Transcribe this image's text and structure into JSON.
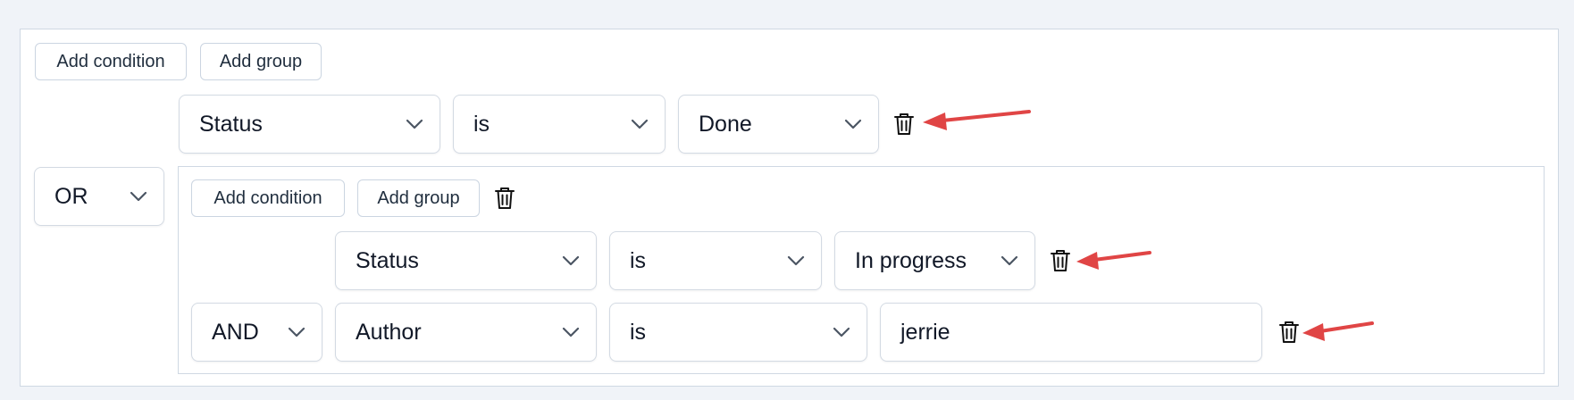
{
  "colors": {
    "annotation_arrow": "#e04545",
    "border": "#cfd8e3",
    "page_bg": "#f0f3f8"
  },
  "root": {
    "add_condition_label": "Add condition",
    "add_group_label": "Add group",
    "combinator": "OR",
    "rule1": {
      "field": "Status",
      "operator": "is",
      "value": "Done"
    }
  },
  "subgroup": {
    "add_condition_label": "Add condition",
    "add_group_label": "Add group",
    "rule1": {
      "field": "Status",
      "operator": "is",
      "value": "In progress"
    },
    "combinator": "AND",
    "rule2": {
      "field": "Author",
      "operator": "is",
      "value": "jerrie"
    }
  },
  "icons": {
    "chevron": "chevron-down-icon",
    "delete": "trash-icon"
  }
}
